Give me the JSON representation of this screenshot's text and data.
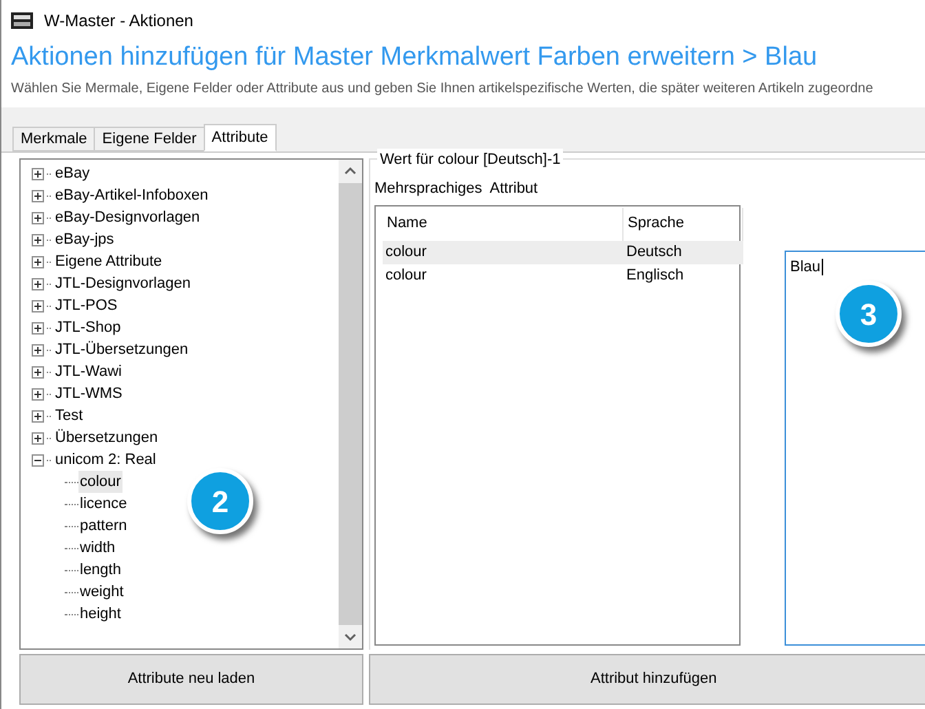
{
  "window": {
    "title": "W-Master - Aktionen"
  },
  "heading": "Aktionen hinzufügen für Master Merkmalwert Farben erweitern > Blau",
  "subtitle": "Wählen Sie Mermale, Eigene Felder oder Attribute aus und geben Sie Ihnen artikelspezifische Werten, die später weiteren Artikeln zugeordne",
  "tabs": [
    {
      "label": "Merkmale",
      "selected": false
    },
    {
      "label": "Eigene Felder",
      "selected": false
    },
    {
      "label": "Attribute",
      "selected": true
    }
  ],
  "tree": [
    {
      "label": "eBay",
      "expanded": false
    },
    {
      "label": "eBay-Artikel-Infoboxen",
      "expanded": false
    },
    {
      "label": "eBay-Designvorlagen",
      "expanded": false
    },
    {
      "label": "eBay-jps",
      "expanded": false
    },
    {
      "label": "Eigene Attribute",
      "expanded": false
    },
    {
      "label": "JTL-Designvorlagen",
      "expanded": false
    },
    {
      "label": "JTL-POS",
      "expanded": false
    },
    {
      "label": "JTL-Shop",
      "expanded": false
    },
    {
      "label": "JTL-Übersetzungen",
      "expanded": false
    },
    {
      "label": "JTL-Wawi",
      "expanded": false
    },
    {
      "label": "JTL-WMS",
      "expanded": false
    },
    {
      "label": "Test",
      "expanded": false
    },
    {
      "label": "Übersetzungen",
      "expanded": false
    },
    {
      "label": "unicom 2: Real",
      "expanded": true,
      "children": [
        {
          "label": "colour",
          "selected": true
        },
        {
          "label": "licence",
          "selected": false
        },
        {
          "label": "pattern",
          "selected": false
        },
        {
          "label": "width",
          "selected": false
        },
        {
          "label": "length",
          "selected": false
        },
        {
          "label": "weight",
          "selected": false
        },
        {
          "label": "height",
          "selected": false
        }
      ]
    }
  ],
  "reload_button": "Attribute neu laden",
  "group": {
    "title": "Wert für colour [Deutsch]-1",
    "subtitle": "Mehrsprachiges  Attribut",
    "columns": [
      "Name",
      "Sprache"
    ],
    "rows": [
      {
        "cells": [
          "colour",
          "Deutsch"
        ],
        "selected": true
      },
      {
        "cells": [
          "colour",
          "Englisch"
        ],
        "selected": false
      }
    ],
    "value": "Blau"
  },
  "add_button": "Attribut hinzufügen",
  "callouts": [
    "2",
    "3"
  ]
}
